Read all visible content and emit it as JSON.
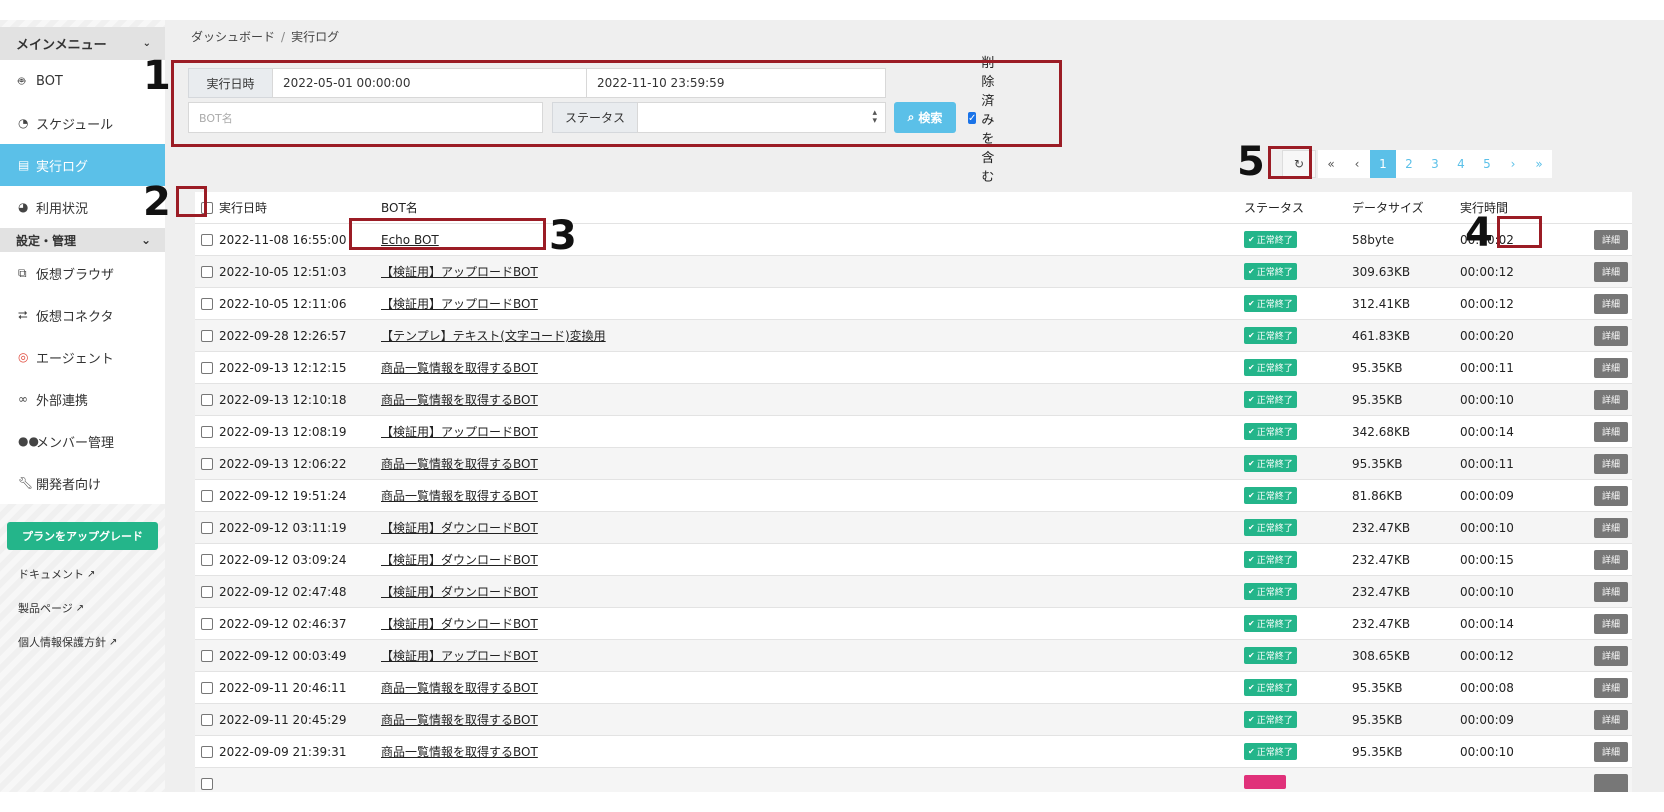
{
  "sidebar": {
    "main_menu": "メインメニュー",
    "items": [
      {
        "label": "BOT",
        "icon": "robot-icon"
      },
      {
        "label": "スケジュール",
        "icon": "clock-icon"
      },
      {
        "label": "実行ログ",
        "icon": "file-icon"
      },
      {
        "label": "利用状況",
        "icon": "pie-chart-icon"
      }
    ],
    "settings_menu": "設定・管理",
    "settings_items": [
      {
        "label": "仮想ブラウザ",
        "icon": "windows-icon"
      },
      {
        "label": "仮想コネクタ",
        "icon": "connector-icon"
      },
      {
        "label": "エージェント",
        "icon": "agent-icon"
      },
      {
        "label": "外部連携",
        "icon": "link-icon"
      },
      {
        "label": "メンバー管理",
        "icon": "users-icon"
      },
      {
        "label": "開発者向け",
        "icon": "wrench-icon"
      }
    ],
    "upgrade_label": "プランをアップグレード",
    "links": [
      "ドキュメント",
      "製品ページ",
      "個人情報保護方針"
    ]
  },
  "breadcrumb": {
    "home": "ダッシュボード",
    "sep": "/",
    "current": "実行ログ"
  },
  "filter": {
    "date_label": "実行日時",
    "date_from": "2022-05-01 00:00:00",
    "date_to": "2022-11-10 23:59:59",
    "bot_placeholder": "BOT名",
    "status_label": "ステータス",
    "search_label": "検索",
    "include_deleted": "削除済みを含む"
  },
  "pagination": {
    "first": "«",
    "prev": "‹",
    "pages": [
      "1",
      "2",
      "3",
      "4",
      "5"
    ],
    "next": "›",
    "last": "»"
  },
  "table": {
    "headers": {
      "date": "実行日時",
      "name": "BOT名",
      "status": "ステータス",
      "size": "データサイズ",
      "time": "実行時間"
    },
    "detail_label": "詳細",
    "rows": [
      {
        "date": "2022-11-08 16:55:00",
        "name": "Echo BOT",
        "status": "正常終了",
        "size": "58byte",
        "time": "00:00:02"
      },
      {
        "date": "2022-10-05 12:51:03",
        "name": "【検証用】アップロードBOT",
        "status": "正常終了",
        "size": "309.63KB",
        "time": "00:00:12"
      },
      {
        "date": "2022-10-05 12:11:06",
        "name": "【検証用】アップロードBOT",
        "status": "正常終了",
        "size": "312.41KB",
        "time": "00:00:12"
      },
      {
        "date": "2022-09-28 12:26:57",
        "name": "【テンプレ】テキスト(文字コード)変換用",
        "status": "正常終了",
        "size": "461.83KB",
        "time": "00:00:20"
      },
      {
        "date": "2022-09-13 12:12:15",
        "name": "商品一覧情報を取得するBOT",
        "status": "正常終了",
        "size": "95.35KB",
        "time": "00:00:11"
      },
      {
        "date": "2022-09-13 12:10:18",
        "name": "商品一覧情報を取得するBOT",
        "status": "正常終了",
        "size": "95.35KB",
        "time": "00:00:10"
      },
      {
        "date": "2022-09-13 12:08:19",
        "name": "【検証用】アップロードBOT",
        "status": "正常終了",
        "size": "342.68KB",
        "time": "00:00:14"
      },
      {
        "date": "2022-09-13 12:06:22",
        "name": "商品一覧情報を取得するBOT",
        "status": "正常終了",
        "size": "95.35KB",
        "time": "00:00:11"
      },
      {
        "date": "2022-09-12 19:51:24",
        "name": "商品一覧情報を取得するBOT",
        "status": "正常終了",
        "size": "81.86KB",
        "time": "00:00:09"
      },
      {
        "date": "2022-09-12 03:11:19",
        "name": "【検証用】ダウンロードBOT",
        "status": "正常終了",
        "size": "232.47KB",
        "time": "00:00:10"
      },
      {
        "date": "2022-09-12 03:09:24",
        "name": "【検証用】ダウンロードBOT",
        "status": "正常終了",
        "size": "232.47KB",
        "time": "00:00:15"
      },
      {
        "date": "2022-09-12 02:47:48",
        "name": "【検証用】ダウンロードBOT",
        "status": "正常終了",
        "size": "232.47KB",
        "time": "00:00:10"
      },
      {
        "date": "2022-09-12 02:46:37",
        "name": "【検証用】ダウンロードBOT",
        "status": "正常終了",
        "size": "232.47KB",
        "time": "00:00:14"
      },
      {
        "date": "2022-09-12 00:03:49",
        "name": "【検証用】アップロードBOT",
        "status": "正常終了",
        "size": "308.65KB",
        "time": "00:00:12"
      },
      {
        "date": "2022-09-11 20:46:11",
        "name": "商品一覧情報を取得するBOT",
        "status": "正常終了",
        "size": "95.35KB",
        "time": "00:00:08"
      },
      {
        "date": "2022-09-11 20:45:29",
        "name": "商品一覧情報を取得するBOT",
        "status": "正常終了",
        "size": "95.35KB",
        "time": "00:00:09"
      },
      {
        "date": "2022-09-09 21:39:31",
        "name": "商品一覧情報を取得するBOT",
        "status": "正常終了",
        "size": "95.35KB",
        "time": "00:00:10"
      }
    ]
  },
  "annotations": [
    "1",
    "2",
    "3",
    "4",
    "5"
  ],
  "colors": {
    "accent": "#5bc0e8",
    "success": "#24b58a",
    "annotation": "#9b1c25",
    "error": "#e0317a"
  }
}
